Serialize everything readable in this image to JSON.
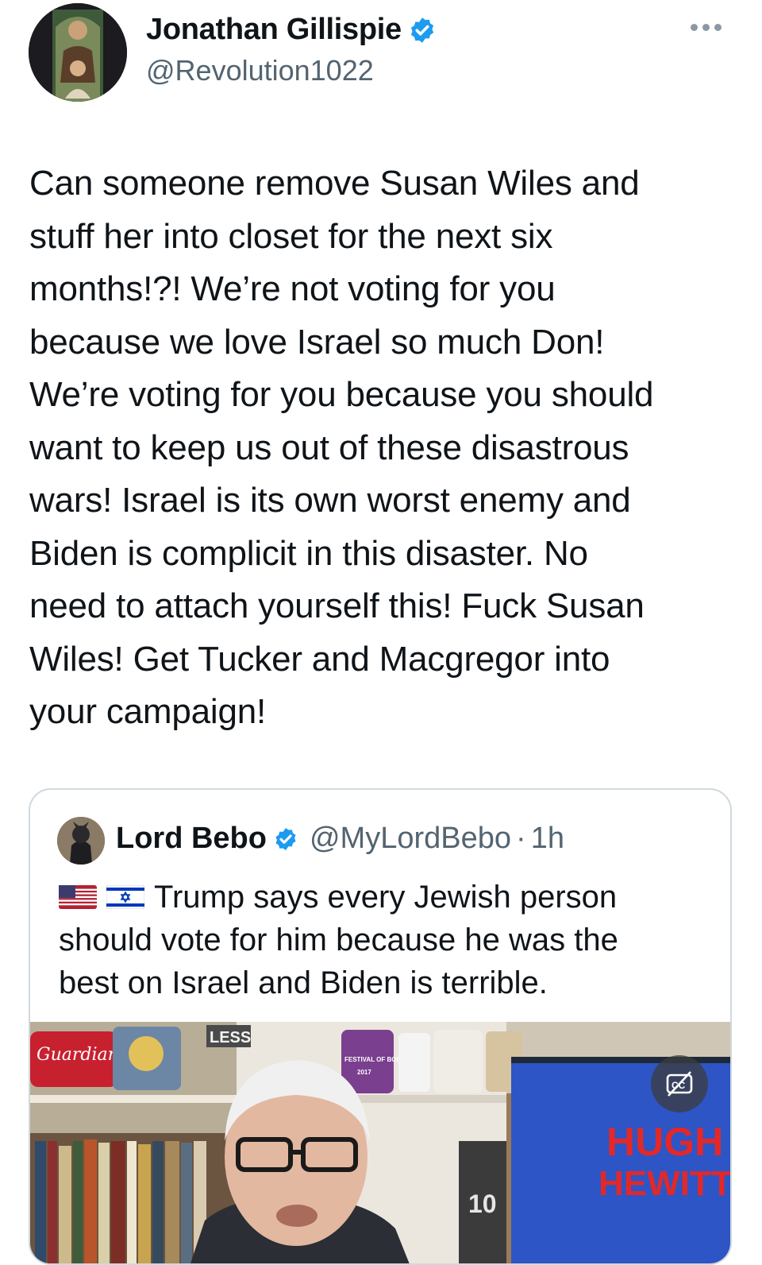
{
  "author": {
    "display_name": "Jonathan Gillispie",
    "handle": "@Revolution1022",
    "verified_color": "#1d9bf0"
  },
  "menu_icon": "more-horizontal-icon",
  "tweet": {
    "text": "Can someone remove Susan Wiles and\nstuff her into closet for the next six\nmonths!?! We’re not voting for you\nbecause we love Israel so much Don!\nWe’re voting for you because you should\nwant to keep us out of these disastrous\nwars! Israel is its own worst enemy and\nBiden is complicit in this disaster. No\nneed to attach yourself this! Fuck Susan\nWiles! Get Tucker and Macgregor into\nyour campaign!"
  },
  "quoted": {
    "display_name": "Lord Bebo",
    "handle": "@MyLordBebo",
    "separator": "·",
    "time": "1h",
    "flags": [
      "us-flag",
      "israel-flag"
    ],
    "text": "Trump says every Jewish person\nshould vote for him because he was the\nbest on Israel and Biden is terrible.",
    "media": {
      "signage": [
        "Guardians",
        "LESS",
        "FESTIVAL OF BOOKS",
        "2017",
        "HUGH",
        "HEWITT",
        "10"
      ],
      "captions_icon": "captions-off-icon"
    }
  }
}
